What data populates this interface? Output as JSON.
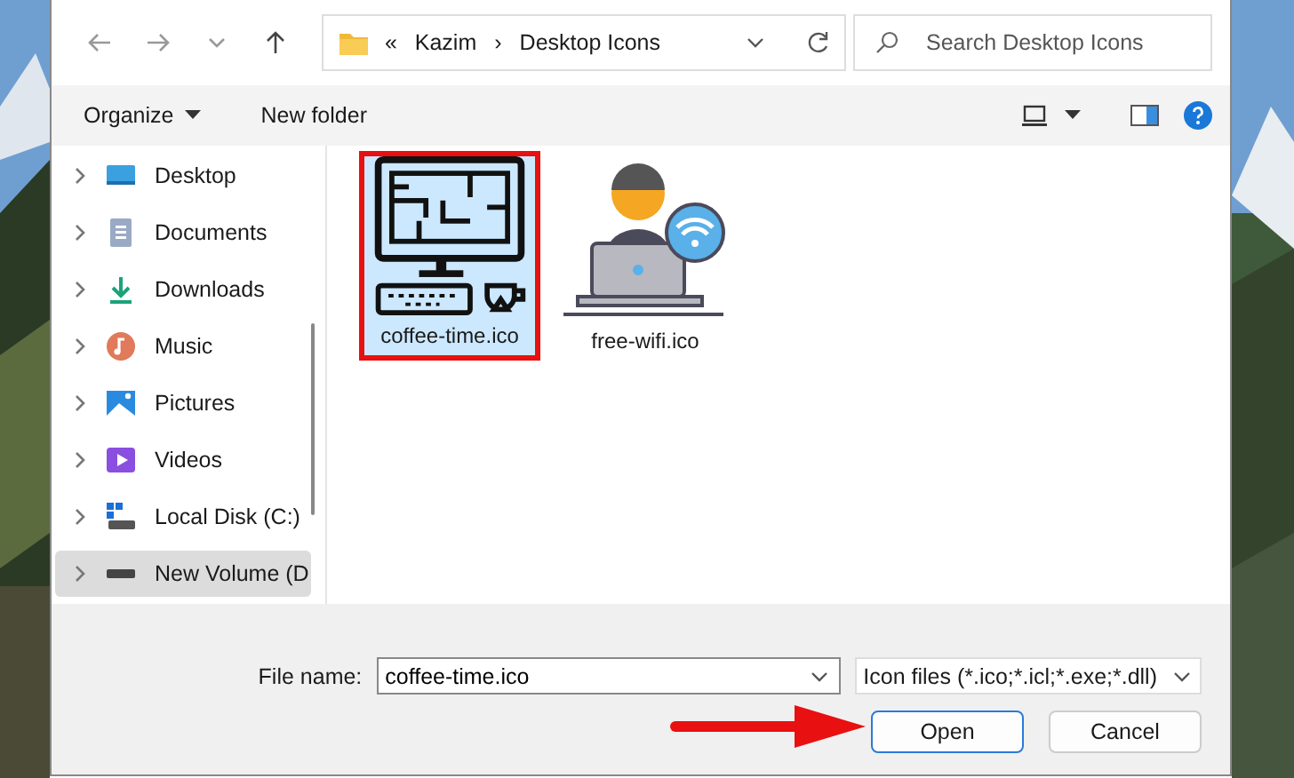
{
  "address": {
    "overflow": "«",
    "separator": "›",
    "breadcrumbs": [
      "Kazim",
      "Desktop Icons"
    ]
  },
  "search": {
    "placeholder": "Search Desktop Icons"
  },
  "toolbar": {
    "organize": "Organize",
    "new_folder": "New folder"
  },
  "sidebar": {
    "items": [
      {
        "label": "Desktop",
        "kind": "desktop",
        "selected": false
      },
      {
        "label": "Documents",
        "kind": "documents",
        "selected": false
      },
      {
        "label": "Downloads",
        "kind": "downloads",
        "selected": false
      },
      {
        "label": "Music",
        "kind": "music",
        "selected": false
      },
      {
        "label": "Pictures",
        "kind": "pictures",
        "selected": false
      },
      {
        "label": "Videos",
        "kind": "videos",
        "selected": false
      },
      {
        "label": "Local Disk (C:)",
        "kind": "system-disk",
        "selected": false
      },
      {
        "label": "New Volume (D",
        "kind": "disk",
        "selected": true
      }
    ]
  },
  "files": [
    {
      "name": "coffee-time.ico",
      "kind": "computer",
      "selected": true,
      "highlighted": true
    },
    {
      "name": "free-wifi.ico",
      "kind": "wifi-user",
      "selected": false,
      "highlighted": false
    }
  ],
  "file_name": {
    "label": "File name:",
    "value": "coffee-time.ico"
  },
  "file_type": {
    "value": "Icon files (*.ico;*.icl;*.exe;*.dll)"
  },
  "buttons": [
    {
      "label": "Open",
      "kind": "primary"
    },
    {
      "label": "Cancel",
      "kind": "secondary"
    }
  ],
  "annotation": {
    "kind": "arrow"
  }
}
